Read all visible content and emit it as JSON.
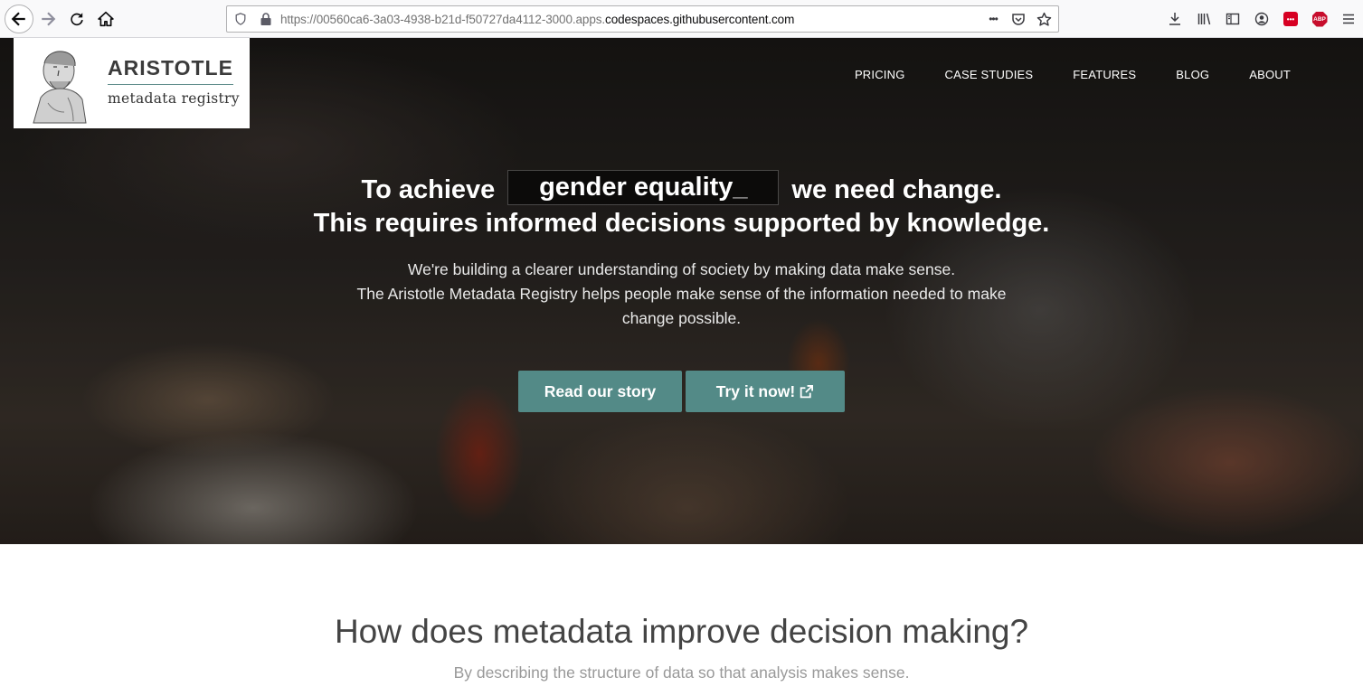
{
  "browser": {
    "url_prefix": "https://00560ca6-3a03-4938-b21d-f50727da4112-3000.apps.",
    "url_host": "codespaces.githubusercontent.com",
    "url_menu_glyph": "•••"
  },
  "logo": {
    "title": "ARISTOTLE",
    "subtitle": "metadata registry"
  },
  "nav": {
    "items": [
      "PRICING",
      "CASE STUDIES",
      "FEATURES",
      "BLOG",
      "ABOUT"
    ]
  },
  "hero": {
    "headline_prefix": "To achieve",
    "typed_word": "gender equality",
    "typed_cursor": "_",
    "headline_suffix": "we need change.",
    "headline_line2": "This requires informed decisions supported by knowledge.",
    "sub_line1": "We're building a clearer understanding of society by making data make sense.",
    "sub_line2": "The Aristotle Metadata Registry helps people make sense of the information needed to make change possible.",
    "btn_story": "Read our story",
    "btn_try": "Try it now!"
  },
  "section": {
    "title": "How does metadata improve decision making?",
    "subtitle": "By describing the structure of data so that analysis makes sense."
  },
  "colors": {
    "accent": "#538a87",
    "browser_bg": "#f9f9fa"
  }
}
